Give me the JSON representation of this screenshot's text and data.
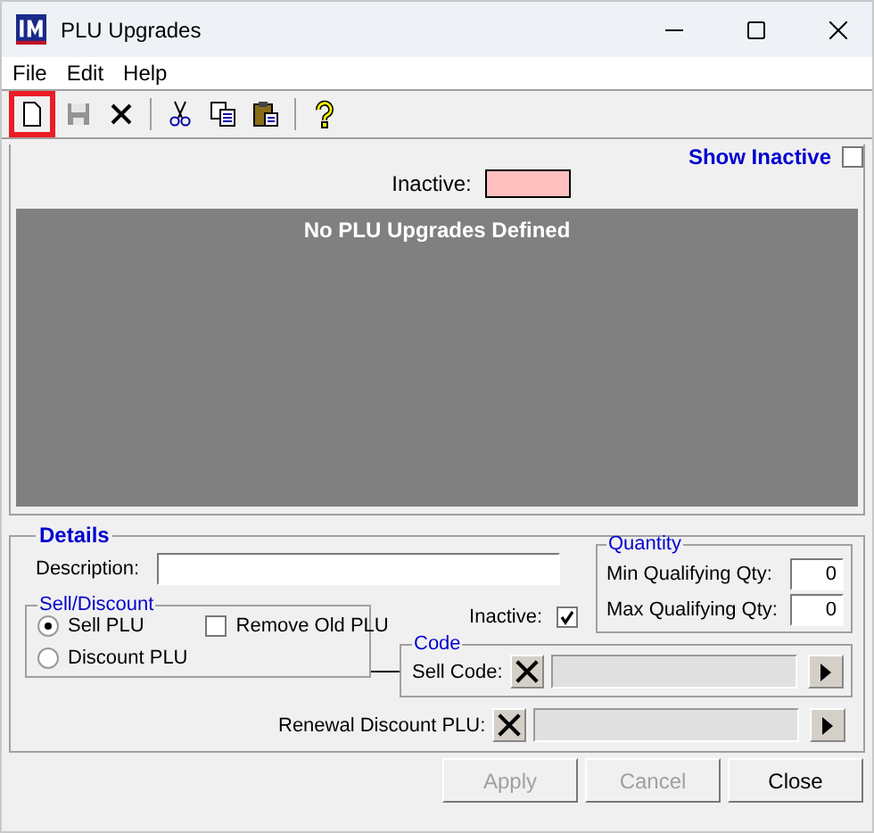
{
  "window": {
    "title": "PLU Upgrades"
  },
  "menu": [
    {
      "label": "File"
    },
    {
      "label": "Edit"
    },
    {
      "label": "Help"
    }
  ],
  "toolbar": [
    {
      "kind": "new",
      "disabled": false,
      "highlighted": true
    },
    {
      "kind": "save",
      "disabled": true,
      "highlighted": false
    },
    {
      "kind": "delete",
      "disabled": false,
      "highlighted": false
    },
    {
      "kind": "separator"
    },
    {
      "kind": "cut",
      "disabled": false,
      "highlighted": false
    },
    {
      "kind": "copy",
      "disabled": false,
      "highlighted": false
    },
    {
      "kind": "paste",
      "disabled": false,
      "highlighted": false
    },
    {
      "kind": "separator"
    },
    {
      "kind": "help",
      "disabled": false,
      "highlighted": false
    }
  ],
  "show_inactive": {
    "label": "Show Inactive",
    "checked": false
  },
  "list_panel": {
    "inactive_label": "Inactive:",
    "empty_message": "No PLU Upgrades Defined"
  },
  "details": {
    "title": "Details",
    "description_label": "Description:",
    "inactive_label": "Inactive:",
    "inactive_checked": true,
    "quantity": {
      "title": "Quantity",
      "min_label": "Min Qualifying Qty:",
      "min_value": "0",
      "max_label": "Max Qualifying Qty:",
      "max_value": "0"
    },
    "sell_discount": {
      "title": "Sell/Discount",
      "options": [
        {
          "label": "Sell PLU",
          "selected": true
        },
        {
          "label": "Discount PLU",
          "selected": false
        }
      ],
      "remove_old": {
        "label": "Remove Old PLU",
        "checked": false
      }
    },
    "code": {
      "title": "Code",
      "sell_code_label": "Sell Code:"
    },
    "renewal_label": "Renewal Discount PLU:"
  },
  "buttons": [
    {
      "label": "Apply",
      "disabled": true
    },
    {
      "label": "Cancel",
      "disabled": true
    },
    {
      "label": "Close",
      "disabled": false
    }
  ]
}
